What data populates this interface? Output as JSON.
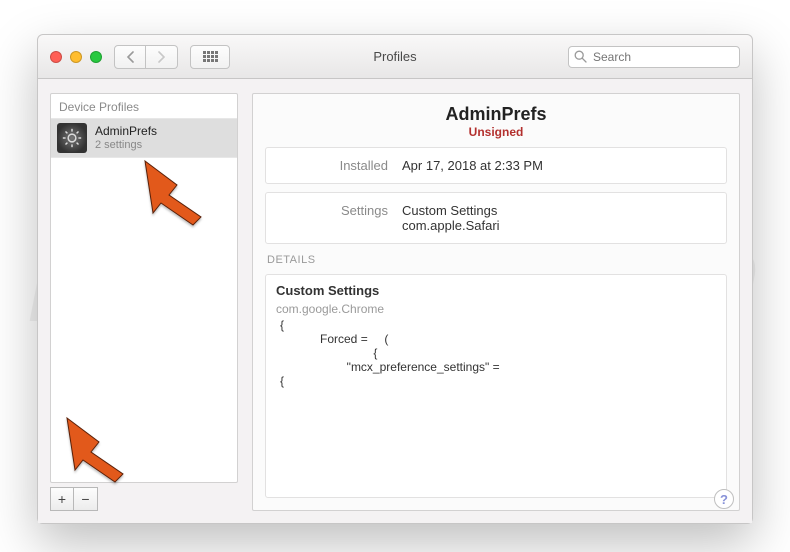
{
  "watermark": "PCrisk.com",
  "window": {
    "title": "Profiles",
    "search_placeholder": "Search"
  },
  "sidebar": {
    "header": "Device Profiles",
    "items": [
      {
        "name": "AdminPrefs",
        "sub": "2 settings"
      }
    ],
    "add_label": "+",
    "remove_label": "−"
  },
  "main": {
    "title": "AdminPrefs",
    "status": "Unsigned",
    "installed_label": "Installed",
    "installed_value": "Apr 17, 2018 at 2:33 PM",
    "settings_label": "Settings",
    "settings_value_1": "Custom Settings",
    "settings_value_2": "com.apple.Safari",
    "details_header": "DETAILS",
    "details_title": "Custom Settings",
    "details_domain": "com.google.Chrome",
    "details_body": "{\n            Forced =     (\n                            {\n                    \"mcx_preference_settings\" =\n{"
  },
  "help": "?"
}
